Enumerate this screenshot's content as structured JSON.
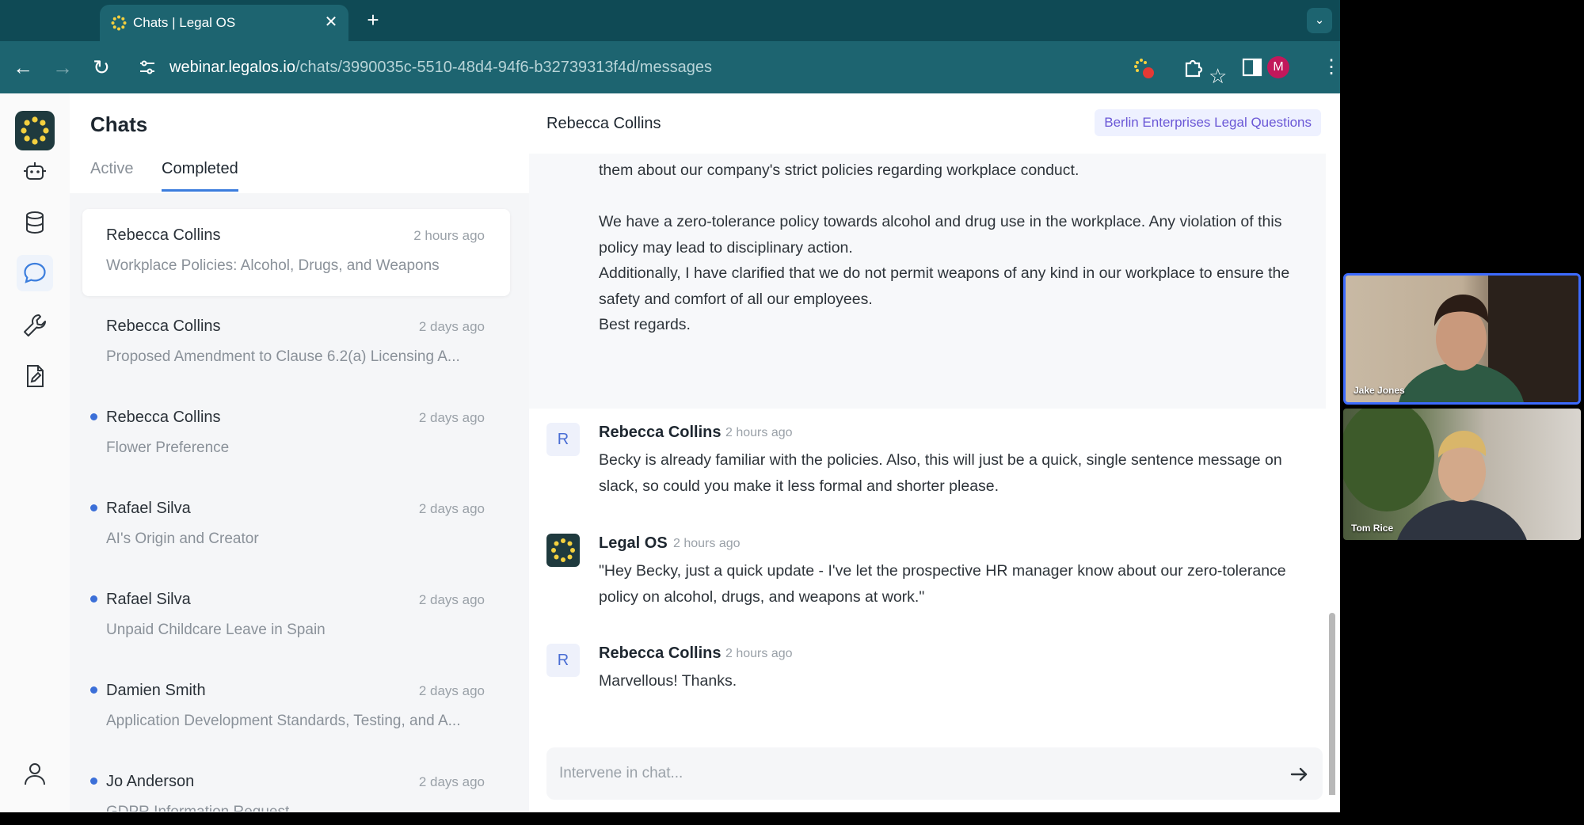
{
  "browser": {
    "tab_title": "Chats | Legal OS",
    "url_host": "webinar.legalos.io",
    "url_path": "/chats/3990035c-5510-48d4-94f6-b32739313f4d/messages",
    "profile_initial": "M"
  },
  "sidebar": {
    "title": "Chats",
    "tabs": [
      "Active",
      "Completed"
    ],
    "active_tab": "Completed"
  },
  "chats": [
    {
      "name": "Rebecca Collins",
      "time": "2 hours ago",
      "subject": "Workplace Policies: Alcohol, Drugs, and Weapons",
      "unread": false,
      "selected": true
    },
    {
      "name": "Rebecca Collins",
      "time": "2 days ago",
      "subject": "Proposed Amendment to Clause 6.2(a) Licensing A...",
      "unread": false,
      "selected": false
    },
    {
      "name": "Rebecca Collins",
      "time": "2 days ago",
      "subject": "Flower Preference",
      "unread": true,
      "selected": false
    },
    {
      "name": "Rafael Silva",
      "time": "2 days ago",
      "subject": "AI's Origin and Creator",
      "unread": true,
      "selected": false
    },
    {
      "name": "Rafael Silva",
      "time": "2 days ago",
      "subject": "Unpaid Childcare Leave in Spain",
      "unread": true,
      "selected": false
    },
    {
      "name": "Damien Smith",
      "time": "2 days ago",
      "subject": "Application Development Standards, Testing, and A...",
      "unread": true,
      "selected": false
    },
    {
      "name": "Jo Anderson",
      "time": "2 days ago",
      "subject": "GDPR Information Request",
      "unread": true,
      "selected": false
    }
  ],
  "chat": {
    "header_name": "Rebecca Collins",
    "badge": "Berlin Enterprises Legal Questions",
    "first_message": {
      "lines": [
        "them about our company's strict policies regarding workplace conduct.",
        "We have a zero-tolerance policy towards alcohol and drug use in the workplace. Any violation of this policy may lead to disciplinary action.",
        "Additionally, I have clarified that we do not permit weapons of any kind in our workplace to ensure the safety and comfort of all our employees.",
        "Best regards."
      ]
    },
    "messages": [
      {
        "avatar": "R",
        "author": "Rebecca Collins",
        "time": "2 hours ago",
        "text": "Becky is already familiar with the policies. Also, this will just be a quick, single sentence message on slack, so could you make it less formal and shorter please."
      },
      {
        "avatar": "",
        "author": "Legal OS",
        "time": "2 hours ago",
        "text": "\"Hey Becky, just a quick update - I've let the prospective HR manager know about our zero-tolerance policy on alcohol, drugs, and weapons at work.\""
      },
      {
        "avatar": "R",
        "author": "Rebecca Collins",
        "time": "2 hours ago",
        "text": "Marvellous! Thanks."
      }
    ],
    "composer_placeholder": "Intervene in chat..."
  },
  "video": {
    "participants": [
      "Jake Jones",
      "Tom Rice"
    ]
  },
  "colors": {
    "browser_frame": "#0f4a55",
    "browser_toolbar": "#1d6470",
    "accent": "#3b7ddd",
    "badge_text": "#6a57d6",
    "unread_dot": "#3b6fd8"
  },
  "icons": [
    "spinner-logo-icon",
    "robot-icon",
    "database-icon",
    "chat-bubble-icon",
    "wrench-icon",
    "document-edit-icon",
    "user-icon",
    "send-arrow-icon"
  ]
}
